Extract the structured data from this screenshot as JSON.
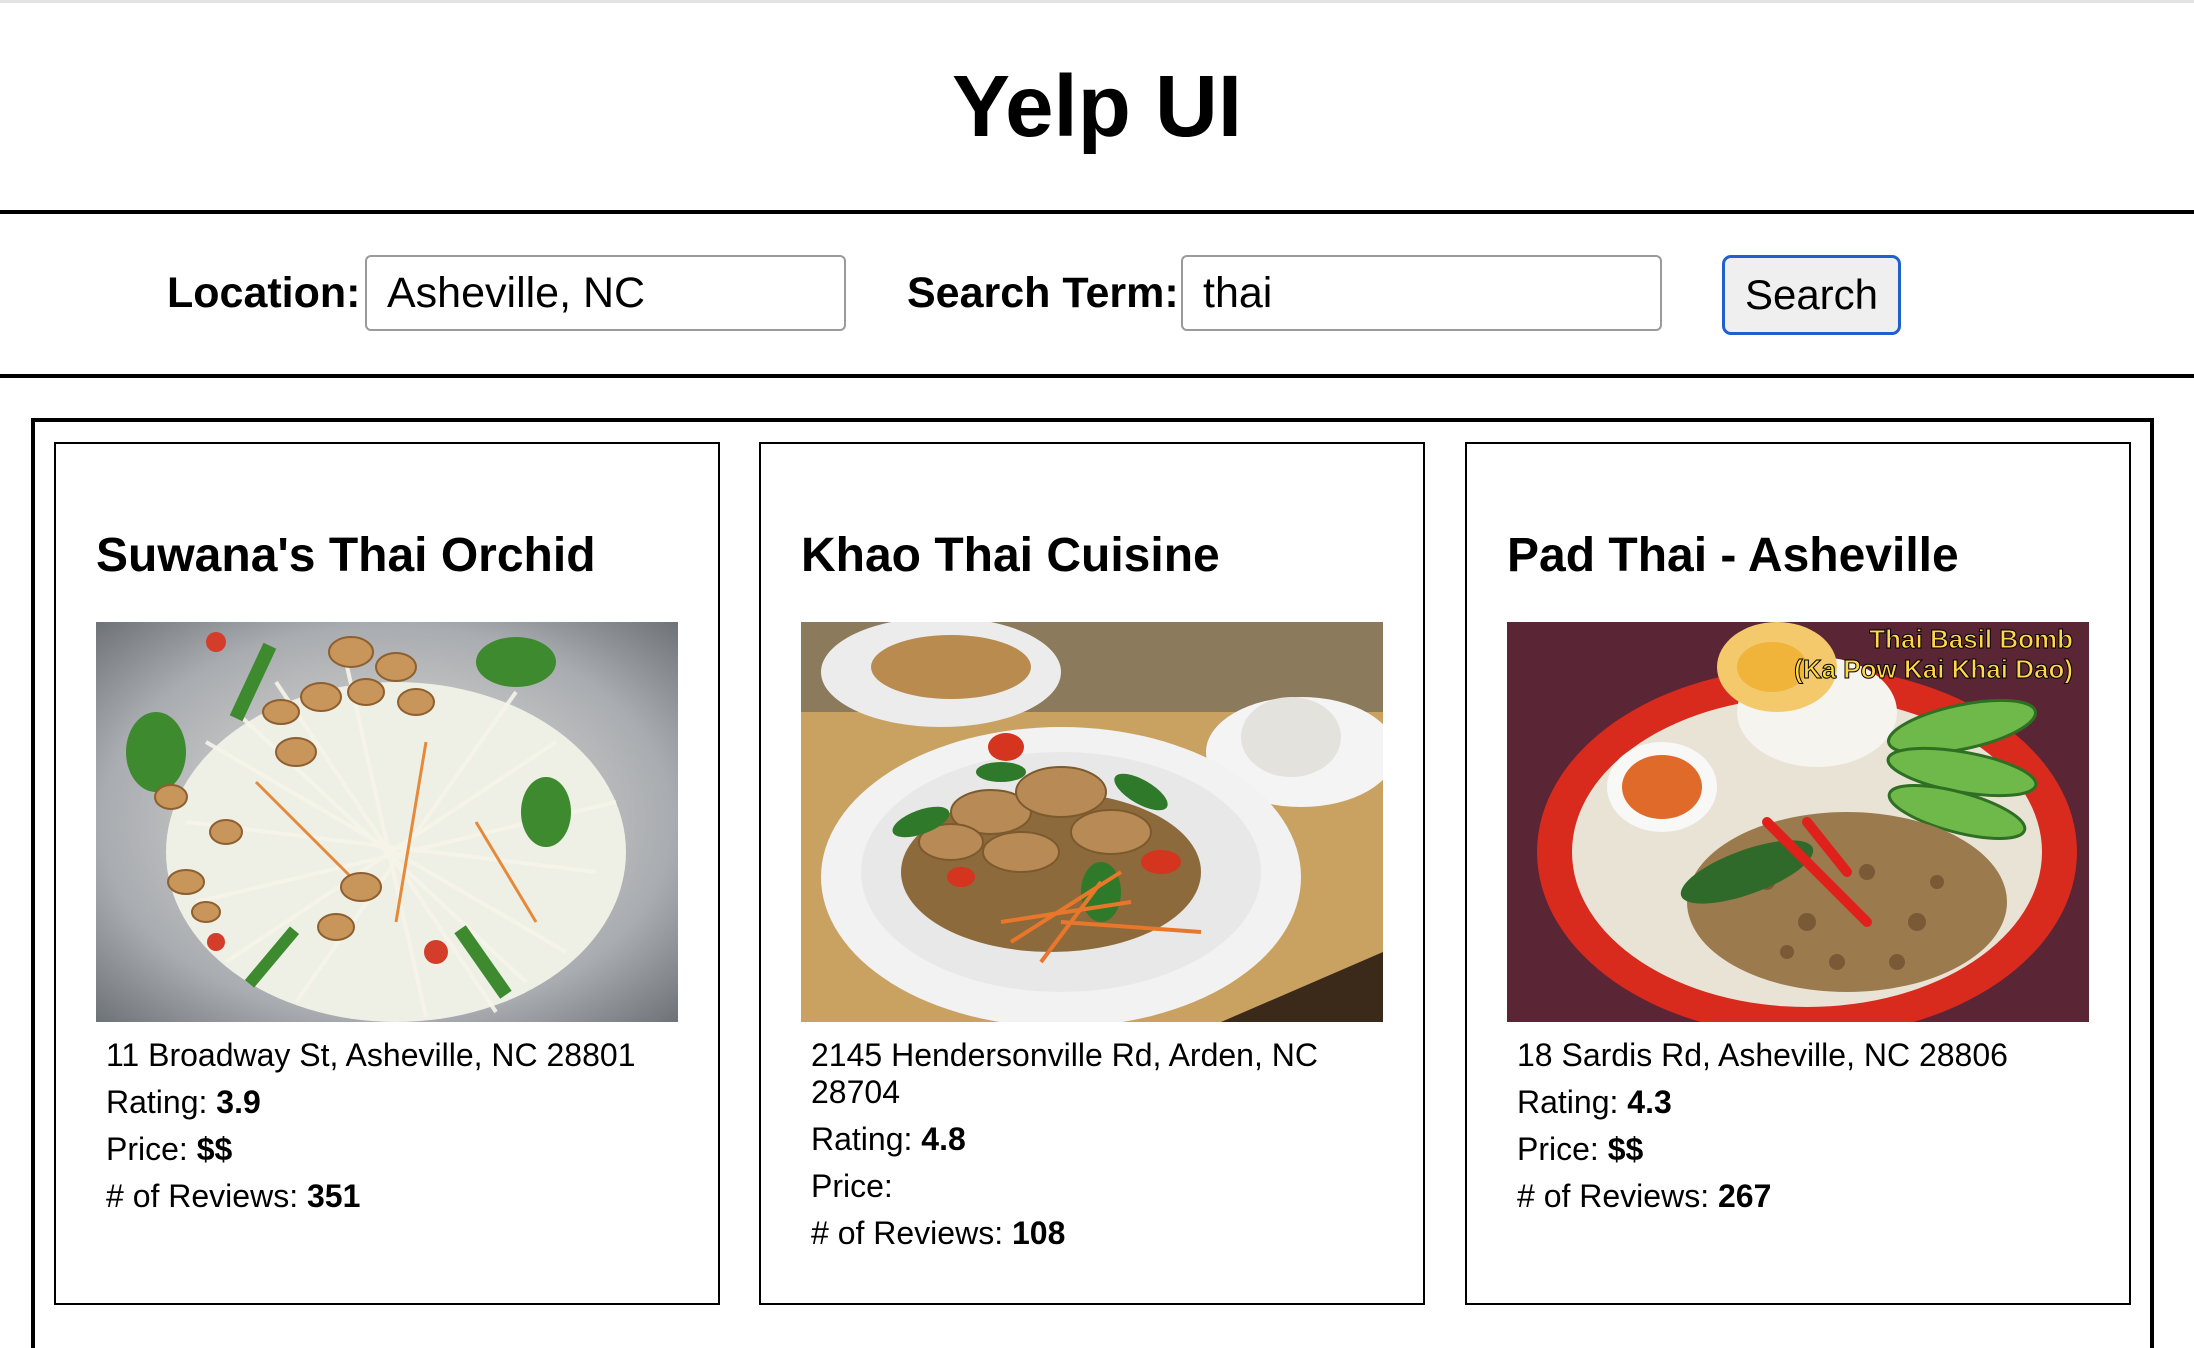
{
  "app": {
    "title": "Yelp UI"
  },
  "search": {
    "location_label": "Location:",
    "location_value": "Asheville, NC",
    "term_label": "Search Term:",
    "term_value": "thai",
    "button_label": "Search"
  },
  "labels": {
    "rating": "Rating:",
    "price": "Price:",
    "reviews": "# of Reviews:"
  },
  "results": [
    {
      "name": "Suwana's Thai Orchid",
      "address": "11 Broadway St, Asheville, NC 28801",
      "rating": "3.9",
      "price": "$$",
      "reviews": "351",
      "photo": "papaya-salad-photo"
    },
    {
      "name": "Khao Thai Cuisine",
      "address": "2145 Hendersonville Rd, Arden, NC 28704",
      "rating": "4.8",
      "price": "",
      "reviews": "108",
      "photo": "stir-fry-plate-photo"
    },
    {
      "name": "Pad Thai - Asheville",
      "address": "18 Sardis Rd, Asheville, NC 28806",
      "rating": "4.3",
      "price": "$$",
      "reviews": "267",
      "photo": "basil-chicken-plate-photo",
      "photo_caption_line1": "Thai Basil Bomb",
      "photo_caption_line2": "(Ka Pow Kai Khai Dao)"
    }
  ]
}
